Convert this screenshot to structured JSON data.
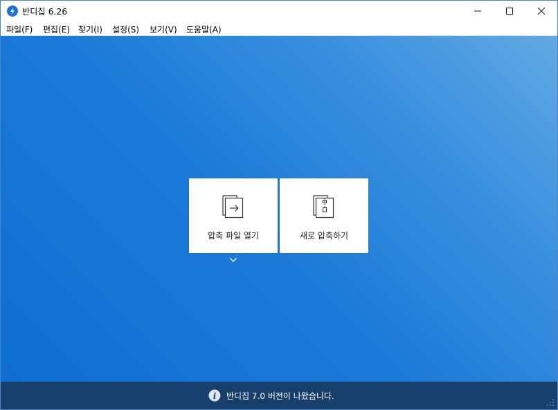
{
  "window": {
    "title": "반디집 6.26",
    "icon": "bandizip-logo-icon"
  },
  "menu": {
    "items": [
      {
        "label": "파일(F)"
      },
      {
        "label": "편집(E)"
      },
      {
        "label": "찾기(I)"
      },
      {
        "label": "설정(S)"
      },
      {
        "label": "보기(V)"
      },
      {
        "label": "도움말(A)"
      }
    ]
  },
  "main": {
    "open_archive_label": "압축 파일 열기",
    "new_archive_label": "새로 압축하기"
  },
  "status": {
    "message": "반디집 7.0 버전이 나왔습니다."
  },
  "colors": {
    "accent": "#1a73d4",
    "statusbar": "#173f6c",
    "gradient_light": "#62a9e3",
    "gradient_dark": "#0f6ed1"
  }
}
